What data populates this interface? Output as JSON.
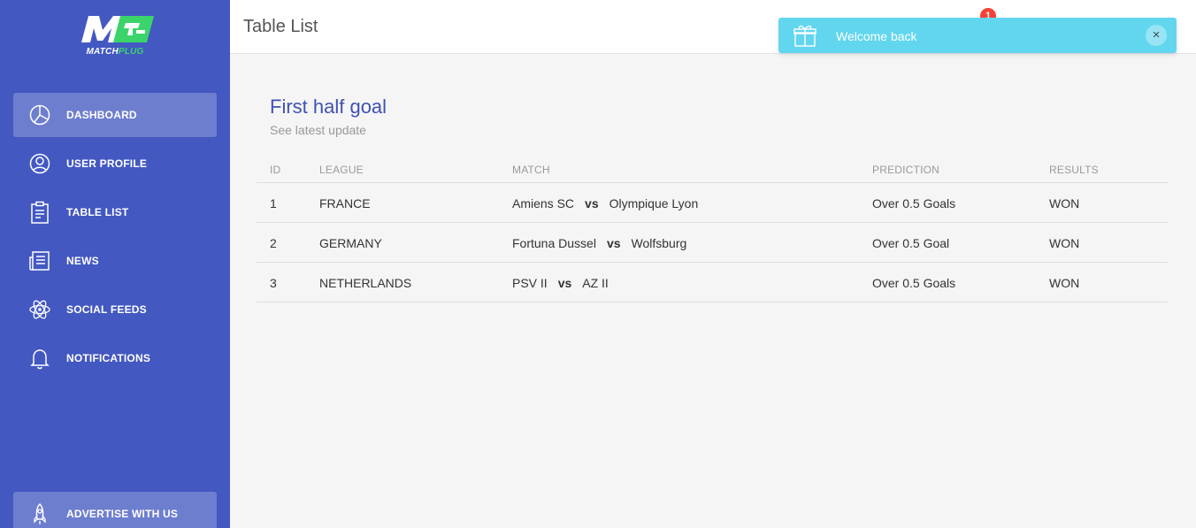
{
  "brand": {
    "logo_word_left": "MATCH",
    "logo_word_right": "PLUG",
    "brand_green": "#3bd46b"
  },
  "sidebar": {
    "items": [
      {
        "label": "DASHBOARD",
        "icon": "pie-chart-icon",
        "active": true
      },
      {
        "label": "USER PROFILE",
        "icon": "user-icon",
        "active": false
      },
      {
        "label": "TABLE LIST",
        "icon": "clipboard-icon",
        "active": false
      },
      {
        "label": "NEWS",
        "icon": "newspaper-icon",
        "active": false
      },
      {
        "label": "SOCIAL FEEDS",
        "icon": "atom-icon",
        "active": false
      },
      {
        "label": "NOTIFICATIONS",
        "icon": "bell-icon",
        "active": false
      }
    ],
    "advertise_label": "ADVERTISE WITH US",
    "advertise_icon": "rocket-icon"
  },
  "header": {
    "title": "Table List",
    "notification_count": "1"
  },
  "toast": {
    "message": "Welcome back",
    "icon": "gift-icon",
    "close_label": "×"
  },
  "card": {
    "title": "First half goal",
    "subtitle": "See latest update",
    "columns": [
      "ID",
      "LEAGUE",
      "MATCH",
      "PREDICTION",
      "RESULTS"
    ],
    "rows": [
      {
        "id": "1",
        "league": "FRANCE",
        "home": "Amiens SC",
        "vs": "vs",
        "away": "Olympique Lyon",
        "prediction": "Over 0.5 Goals",
        "result": "WON"
      },
      {
        "id": "2",
        "league": "GERMANY",
        "home": "Fortuna Dussel",
        "vs": "vs",
        "away": "Wolfsburg",
        "prediction": "Over 0.5 Goal",
        "result": "WON"
      },
      {
        "id": "3",
        "league": "NETHERLANDS",
        "home": "PSV II",
        "vs": "vs",
        "away": "AZ II",
        "prediction": "Over 0.5 Goals",
        "result": "WON"
      }
    ]
  },
  "colors": {
    "sidebar": "#4358c1",
    "accent_title": "#3f51b5",
    "toast": "#62d6ef",
    "badge": "#f44336"
  }
}
